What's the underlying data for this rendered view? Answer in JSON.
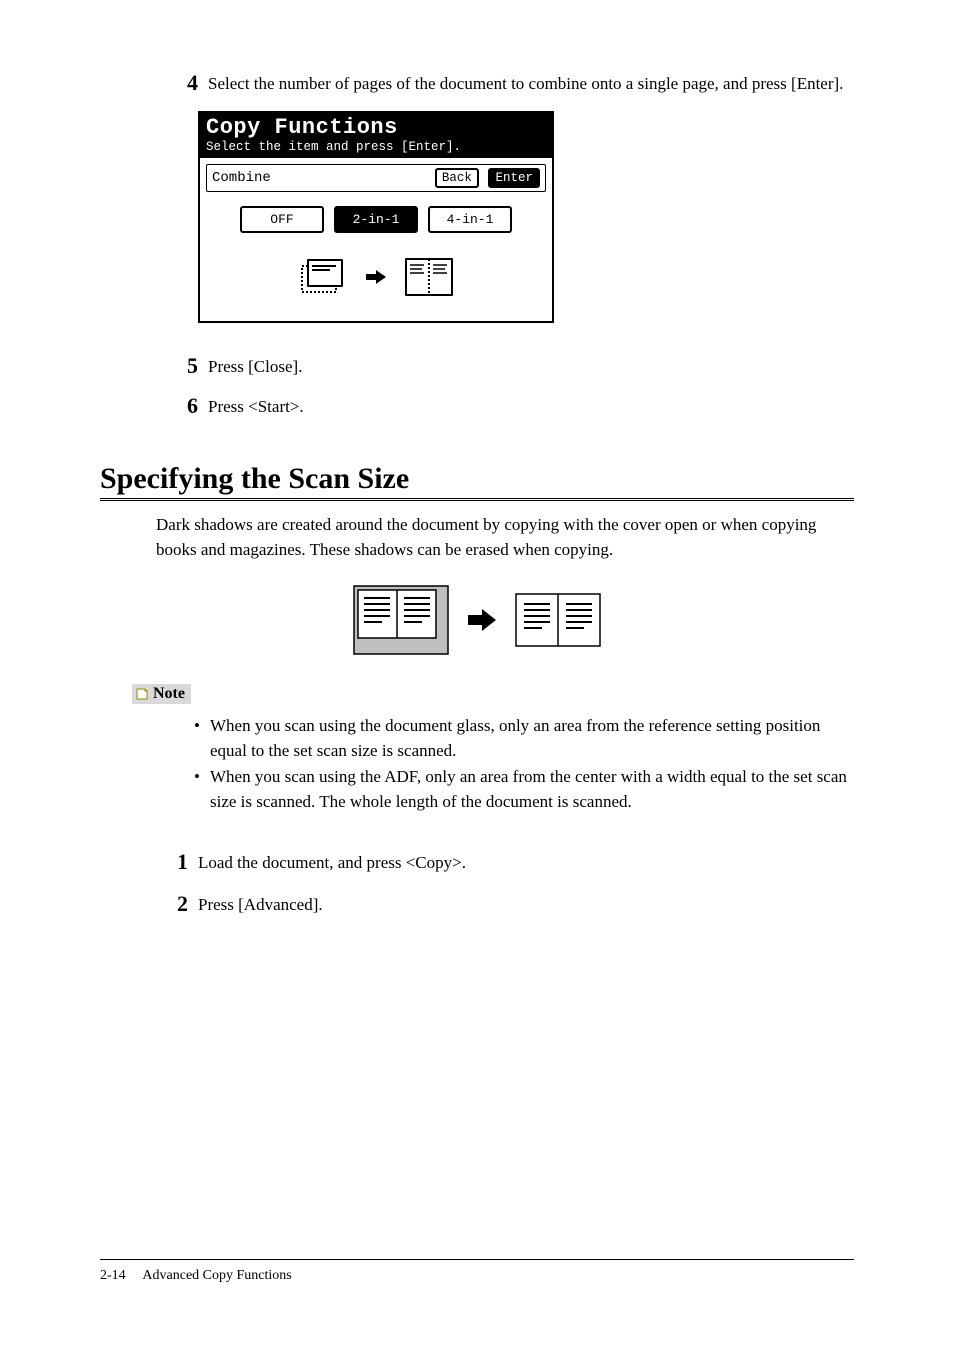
{
  "step4": {
    "num": "4",
    "text": "Select the number of pages of the document to combine onto a single page, and press [Enter]."
  },
  "lcd": {
    "title": "Copy Functions",
    "subtitle": "Select the item and press [Enter].",
    "setting_label": "Combine",
    "back_label": "Back",
    "enter_label": "Enter",
    "options": [
      "OFF",
      "2-in-1",
      "4-in-1"
    ],
    "selected_option": "2-in-1"
  },
  "step5": {
    "num": "5",
    "text": "Press [Close]."
  },
  "step6": {
    "num": "6",
    "text": "Press <Start>."
  },
  "section_heading": "Specifying the Scan Size",
  "section_intro": "Dark shadows are created around the document by copying with the cover open or when copying books and magazines. These shadows can be erased when copying.",
  "note_label": "Note",
  "note_bullets": [
    "When you scan using the document glass, only an area from the reference setting position equal to the set scan size is scanned.",
    "When you scan using the ADF, only an area from the center with a width equal to the set scan size is scanned. The whole length of the document is scanned."
  ],
  "new_step1": {
    "num": "1",
    "text": "Load the document, and press <Copy>."
  },
  "new_step2": {
    "num": "2",
    "text": "Press [Advanced]."
  },
  "footer": {
    "page": "2-14",
    "chapter": "Advanced Copy Functions"
  }
}
